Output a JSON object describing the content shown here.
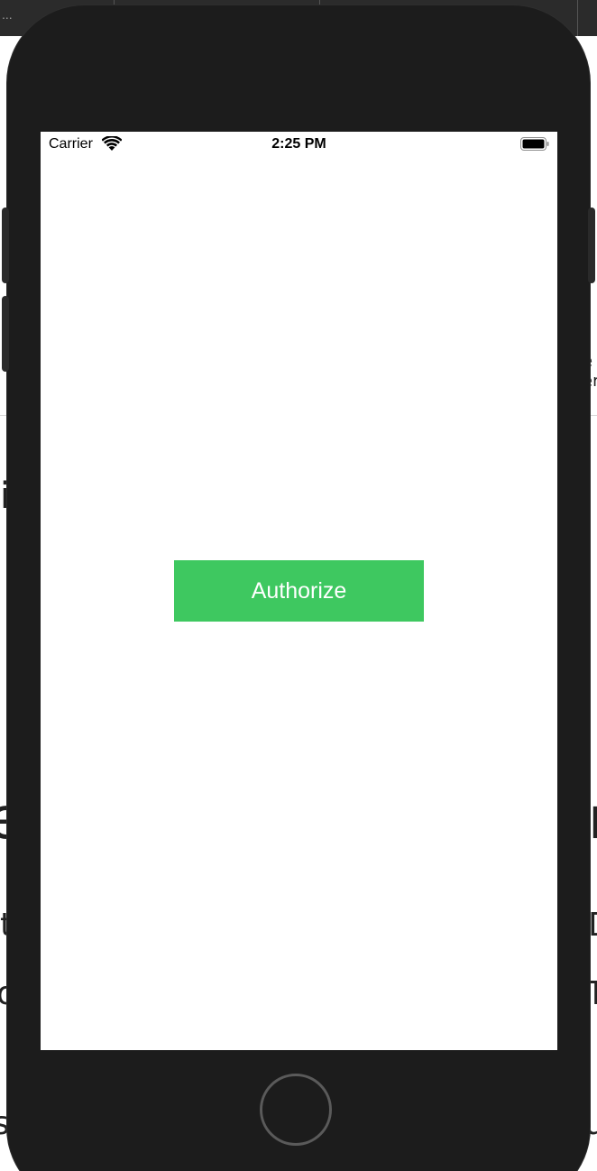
{
  "background": {
    "topbar_menu": "...",
    "fragments": [
      "e",
      "er",
      "i",
      "e",
      "n",
      "t",
      "D",
      "o",
      "T",
      "s",
      "u",
      "r"
    ]
  },
  "status_bar": {
    "carrier": "Carrier",
    "time": "2:25 PM"
  },
  "main": {
    "authorize_label": "Authorize",
    "button_color": "#3ec860"
  },
  "icons": {
    "wifi": "wifi-icon",
    "battery": "battery-icon"
  }
}
